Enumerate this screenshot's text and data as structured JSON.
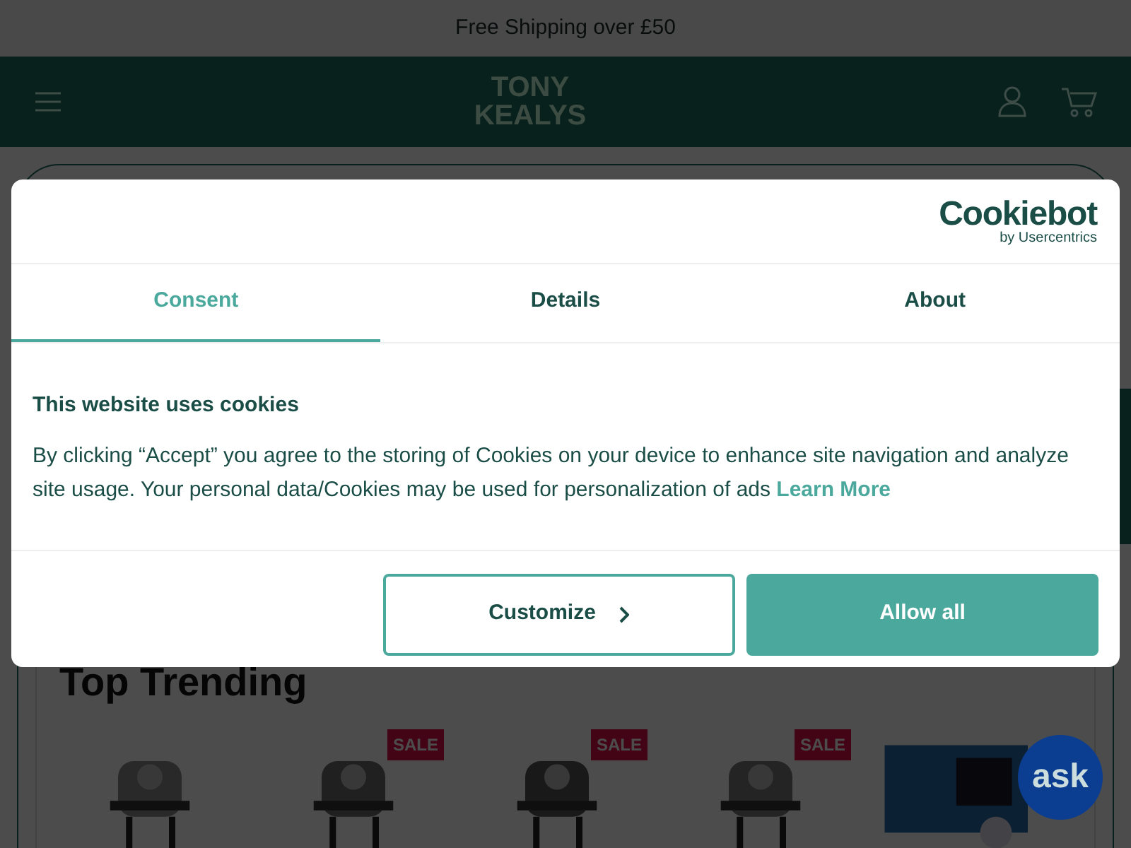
{
  "announcement": "Free Shipping over £50",
  "header": {
    "logo": "TONY KEALYS"
  },
  "section": {
    "title": "Top Trending",
    "products": [
      {
        "kind": "picture"
      },
      {
        "kind": "picture",
        "badge": "SALE"
      },
      {
        "kind": "picture",
        "badge": "SALE"
      },
      {
        "kind": "picture",
        "badge": "SALE"
      },
      {
        "kind": "picture"
      }
    ]
  },
  "chat_button": "ask",
  "cookie_dialog": {
    "brand": "Cookiebot",
    "brand_sub": "by Usercentrics",
    "tabs": [
      {
        "label": "Consent",
        "selected": true
      },
      {
        "label": "Details",
        "selected": false
      },
      {
        "label": "About",
        "selected": false
      }
    ],
    "heading": "This website uses cookies",
    "body": "By clicking “Accept” you agree to the storing of Cookies on your device to enhance site navigation and analyze site usage. Your personal data/Cookies may be used for personalization of ads",
    "link": "Learn More",
    "buttons": [
      {
        "label": "Customize",
        "kind": "outline"
      },
      {
        "label": "Allow all",
        "kind": "filled"
      }
    ]
  }
}
